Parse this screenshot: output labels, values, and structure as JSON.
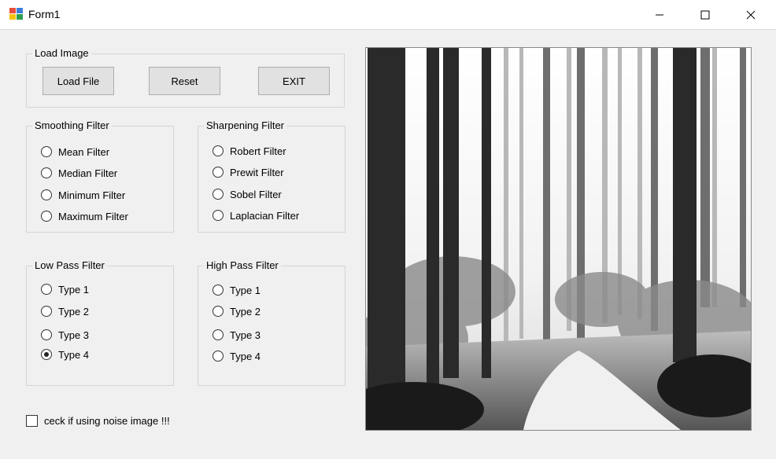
{
  "window": {
    "title": "Form1",
    "minimize_glyph": "—",
    "maximize_glyph": "☐",
    "close_glyph": "✕"
  },
  "load_group": {
    "label": "Load Image",
    "load_button": "Load File",
    "reset_button": "Reset",
    "exit_button": "EXIT"
  },
  "smoothing": {
    "label": "Smoothing Filter",
    "options": [
      "Mean Filter",
      "Median Filter",
      "Minimum Filter",
      "Maximum Filter"
    ]
  },
  "sharpening": {
    "label": "Sharpening Filter",
    "options": [
      "Robert Filter",
      "Prewit Filter",
      "Sobel Filter",
      "Laplacian Filter"
    ]
  },
  "low_pass": {
    "label": "Low Pass Filter",
    "options": [
      "Type 1",
      "Type 2",
      "Type 3",
      "Type 4"
    ],
    "selected": "Type 4"
  },
  "high_pass": {
    "label": "High Pass Filter",
    "options": [
      "Type 1",
      "Type 2",
      "Type 3",
      "Type 4"
    ]
  },
  "noise_checkbox": {
    "label": "ceck if using noise image !!!",
    "checked": false
  },
  "picture": {
    "icon": "forest-path-photo",
    "tone": "grayscale"
  }
}
